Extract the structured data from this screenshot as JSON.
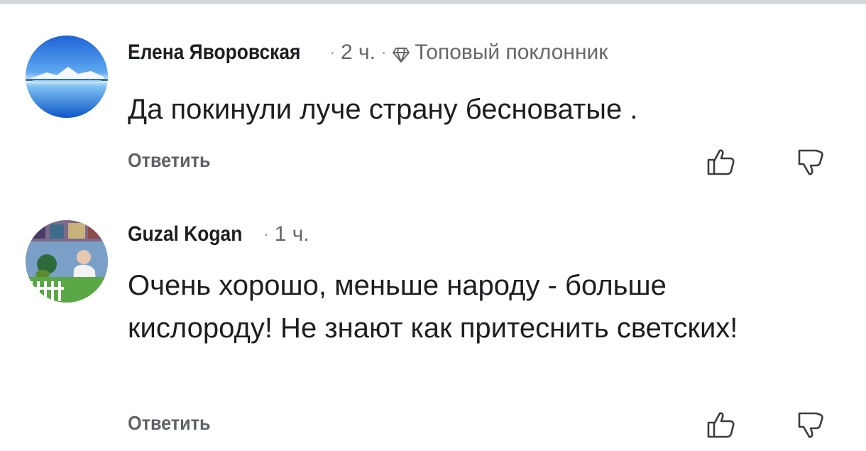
{
  "comments": [
    {
      "author": "Елена Яворовская",
      "time": "2 ч.",
      "badge_icon": "diamond-icon",
      "badge": "Топовый поклонник",
      "text": "Да покинули луче страну бесноватые .",
      "reply_label": "Ответить",
      "like_icon": "thumbs-up-icon",
      "dislike_icon": "thumbs-down-icon"
    },
    {
      "author": "Guzal Kogan",
      "time": "1 ч.",
      "text": "Очень хорошо, меньше народу - больше кислороду! Не знают как притеснить светских!",
      "reply_label": "Ответить",
      "like_icon": "thumbs-up-icon",
      "dislike_icon": "thumbs-down-icon"
    }
  ],
  "colors": {
    "text": "#1c1e21",
    "secondary": "#65676b",
    "reply": "#5f6267",
    "divider": "#d6d7d9"
  }
}
